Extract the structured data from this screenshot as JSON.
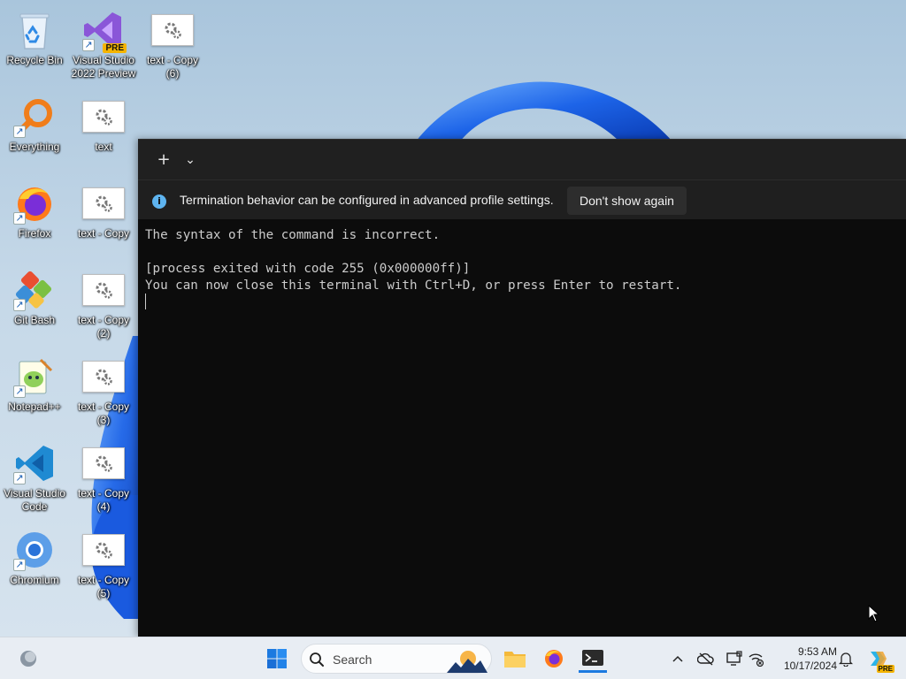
{
  "desktop": {
    "icons": [
      {
        "name": "recycle-bin",
        "label": "Recycle Bin"
      },
      {
        "name": "visual-studio-2022-preview",
        "label": "Visual Studio 2022 Preview",
        "badge": "PRE"
      },
      {
        "name": "text-copy-6",
        "label": "text - Copy (6)"
      },
      {
        "name": "everything",
        "label": "Everything"
      },
      {
        "name": "text",
        "label": "text"
      },
      {
        "name": "firefox",
        "label": "Firefox"
      },
      {
        "name": "text-copy",
        "label": "text - Copy"
      },
      {
        "name": "git-bash",
        "label": "Git Bash"
      },
      {
        "name": "text-copy-2",
        "label": "text - Copy (2)"
      },
      {
        "name": "notepad-plus-plus",
        "label": "Notepad++"
      },
      {
        "name": "text-copy-3",
        "label": "text - Copy (3)"
      },
      {
        "name": "visual-studio-code",
        "label": "Visual Studio Code"
      },
      {
        "name": "text-copy-4",
        "label": "text - Copy (4)"
      },
      {
        "name": "chromium",
        "label": "Chromium"
      },
      {
        "name": "text-copy-5",
        "label": "text - Copy (5)"
      }
    ]
  },
  "terminal": {
    "new_tab_icon": "+",
    "dropdown_icon": "⌄",
    "infobar": {
      "icon": "info-icon",
      "message": "Termination behavior can be configured in advanced profile settings.",
      "button_label": "Don't show again"
    },
    "output": "The syntax of the command is incorrect.\n\n[process exited with code 255 (0x000000ff)]\nYou can now close this terminal with Ctrl+D, or press Enter to restart."
  },
  "taskbar": {
    "search_placeholder": "Search",
    "pinned": [
      "windows-start-icon",
      "file-explorer-icon",
      "firefox-icon",
      "terminal-icon"
    ],
    "tray": [
      "chevron-up-icon",
      "onedrive-offline-icon",
      "display-icon",
      "network-icon"
    ],
    "clock": {
      "time": "9:53 AM",
      "date": "10/17/2024"
    },
    "copilot_badge": "PRE"
  },
  "colors": {
    "terminal_bg": "#0c0c0c",
    "terminal_text": "#cccccc",
    "titlebar_bg": "#202020",
    "accent": "#0078d4"
  }
}
